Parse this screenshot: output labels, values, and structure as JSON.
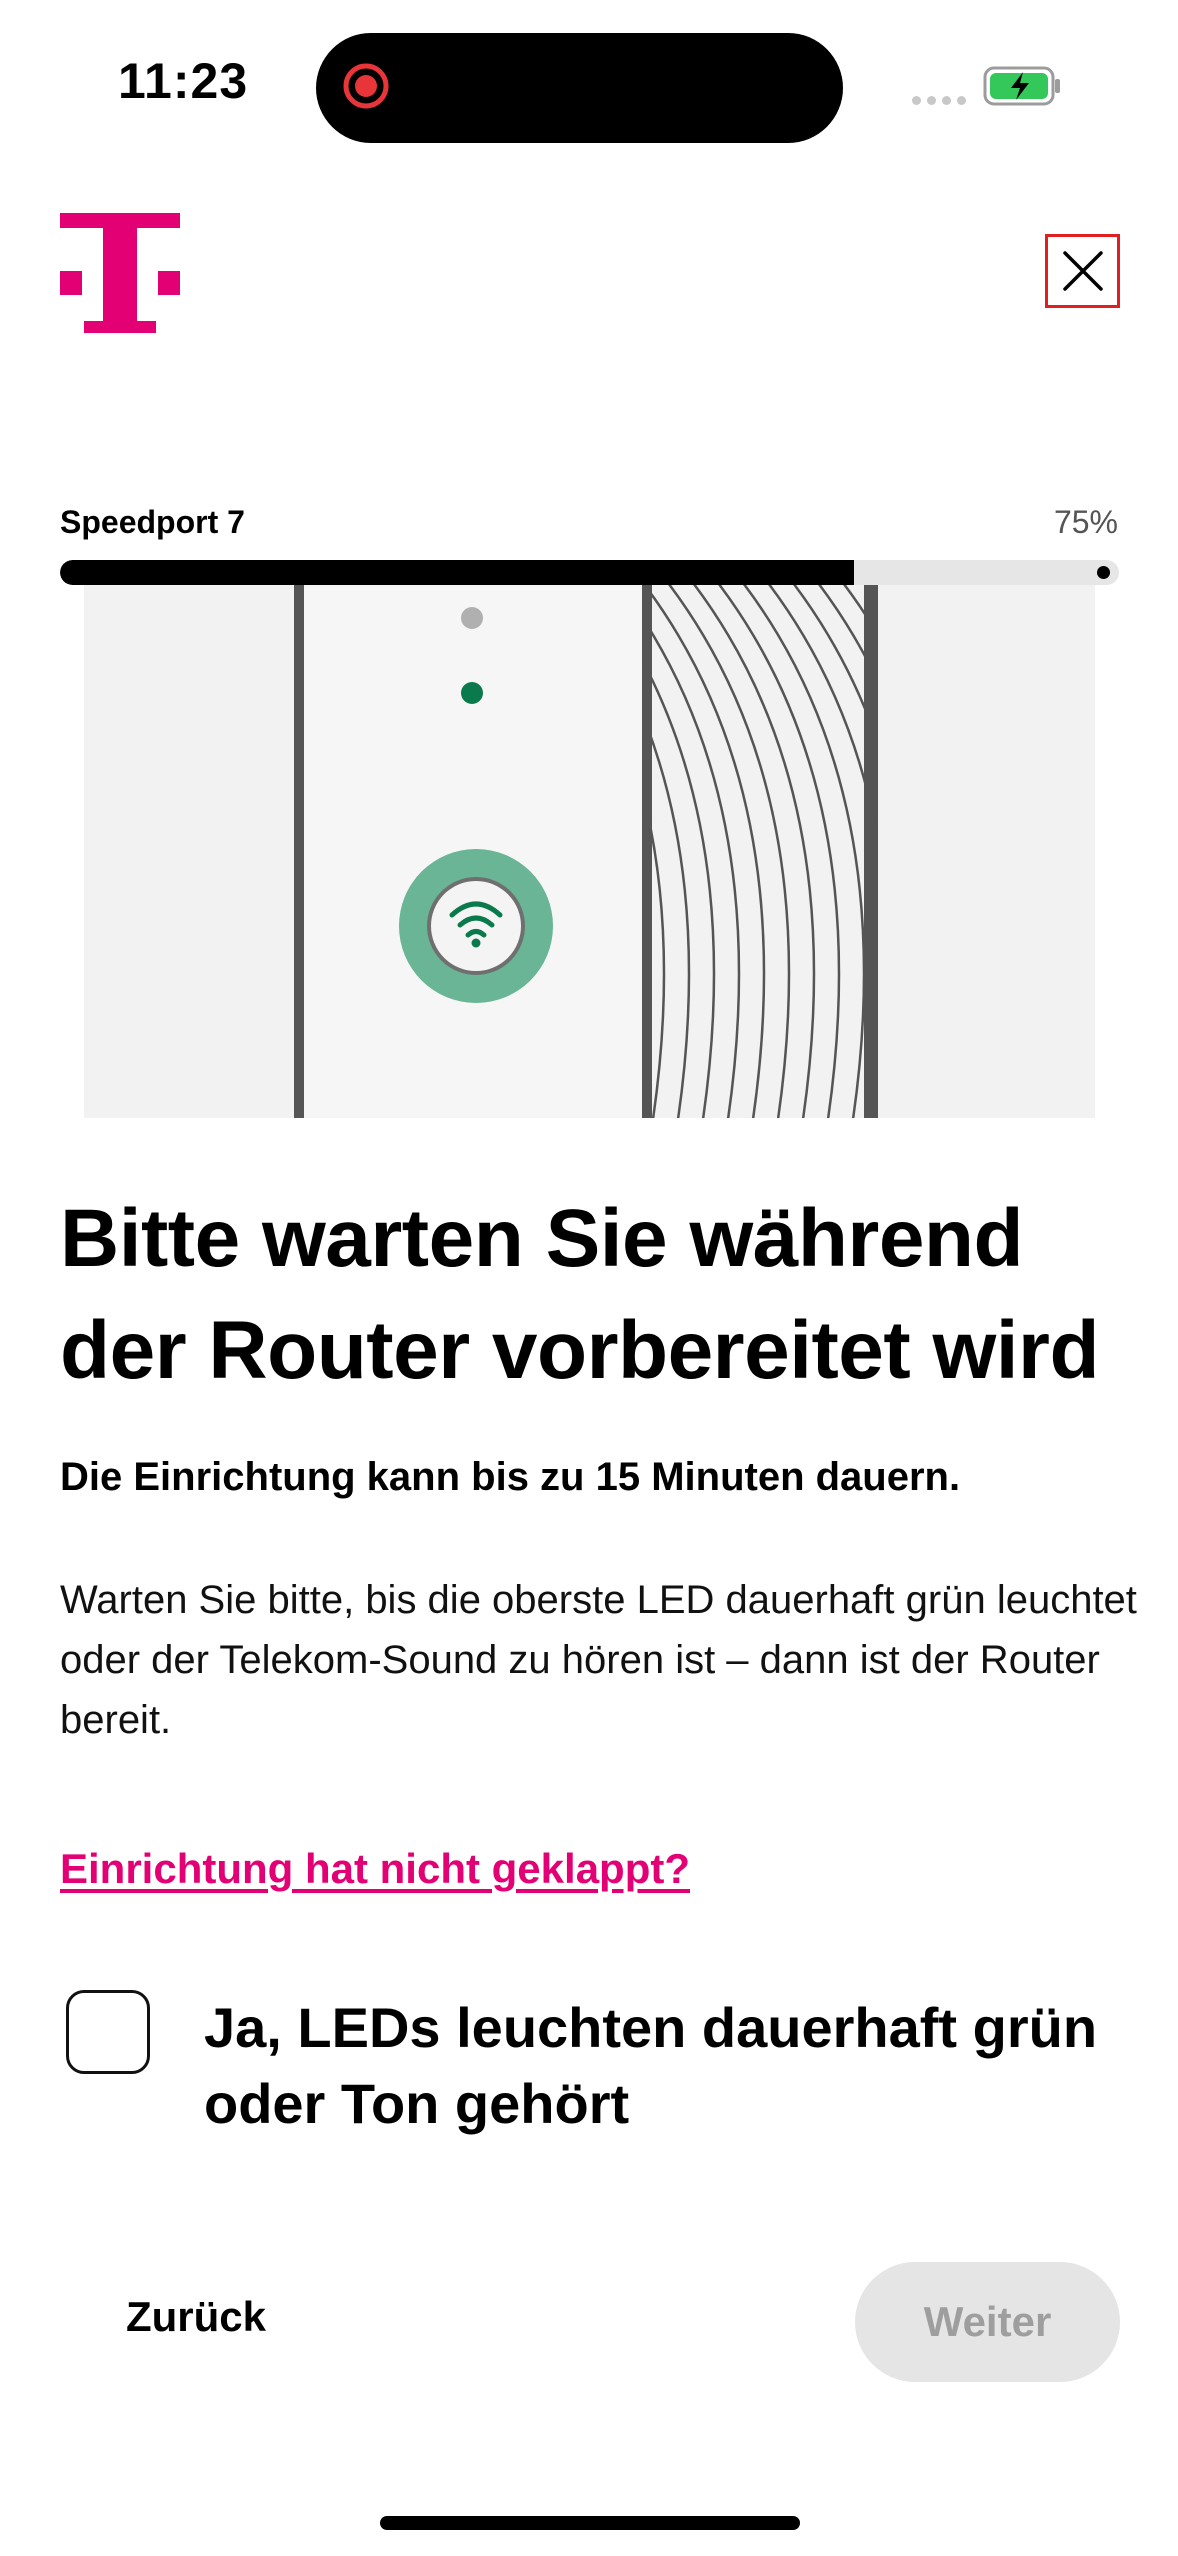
{
  "status": {
    "time": "11:23"
  },
  "brand": {
    "color": "#e20074"
  },
  "progress": {
    "label": "Speedport 7",
    "percent_text": "75%",
    "fraction": 0.75
  },
  "illustration": {
    "led_colors": [
      "#b0b0b0",
      "#0a7a4c"
    ],
    "button_color": "#69b596"
  },
  "main": {
    "headline": "Bitte warten Sie während der Router vorbereitet wird",
    "subtitle": "Die Einrichtung kann bis zu 15 Minuten dauern.",
    "body": "Warten Sie bitte, bis die oberste LED dauerhaft grün leuchtet oder der Telekom-Sound zu hören ist – dann ist der Router bereit.",
    "link": "Einrichtung hat nicht geklappt?"
  },
  "confirm": {
    "label": "Ja, LEDs leuchten dauerhaft grün oder Ton gehört",
    "checked": false
  },
  "footer": {
    "back_label": "Zurück",
    "next_label": "Weiter"
  }
}
